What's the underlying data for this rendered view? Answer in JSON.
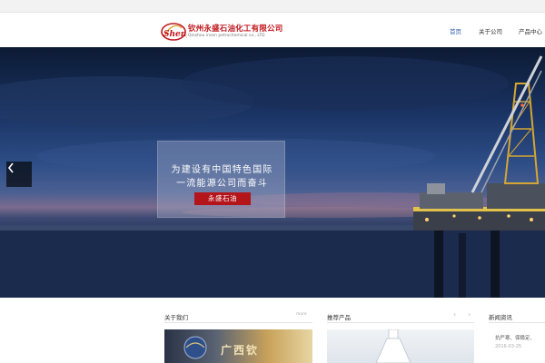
{
  "header": {
    "company_name_cn": "钦州永盛石油化工有限公司",
    "company_name_en": "Qinzhou insen petrochemical co., LTD",
    "logo_script": "Sheng"
  },
  "nav": {
    "items": [
      {
        "label": "首页",
        "active": true
      },
      {
        "label": "关于公司",
        "active": false
      },
      {
        "label": "产品中心",
        "active": false
      }
    ]
  },
  "hero": {
    "caption_line1": "为建设有中国特色国际",
    "caption_line2": "一流能源公司而奋斗",
    "caption_button": "永盛石油",
    "prev_icon": "chevron-left-icon"
  },
  "sections": {
    "about": {
      "title": "关于我们",
      "more": "more",
      "image_text": "广西钦"
    },
    "products": {
      "title": "推荐产品",
      "prev": "‹",
      "next": "›"
    },
    "news": {
      "title": "新闻资讯",
      "item_text": "抗严寒、保稳定、",
      "item_date": "2016-03-25"
    }
  },
  "colors": {
    "brand_red": "#c0161c",
    "nav_active": "#2a5fb0",
    "button_red": "#b3151b"
  }
}
